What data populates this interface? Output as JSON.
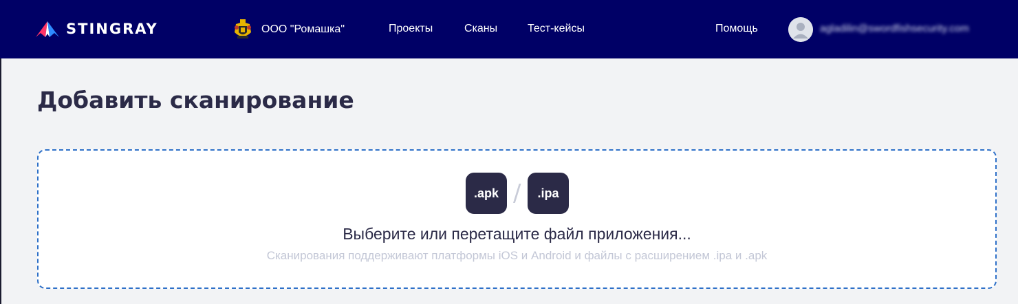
{
  "header": {
    "logo_text": "STINGRAY",
    "org_name": "ООО \"Ромашка\"",
    "nav": [
      {
        "label": "Проекты"
      },
      {
        "label": "Сканы"
      },
      {
        "label": "Тест-кейсы"
      }
    ],
    "help_label": "Помощь",
    "user_email": "agladilin@swordfishsecurity.com",
    "colors": {
      "background": "#000066",
      "text": "#ffffff"
    }
  },
  "main": {
    "title": "Добавить сканирование",
    "dropzone": {
      "badge_apk": ".apk",
      "separator": "/",
      "badge_ipa": ".ipa",
      "prompt": "Выберите или перетащите файл приложения...",
      "hint": "Сканирования поддерживают платформы iOS и Android и файлы с расширением .ipa и .apk",
      "border_color": "#2e70c8",
      "badge_color": "#2b2a47"
    }
  },
  "icons": {
    "logo": "stingray-logo-icon",
    "org": "coat-of-arms-icon",
    "avatar": "user-avatar-icon"
  }
}
